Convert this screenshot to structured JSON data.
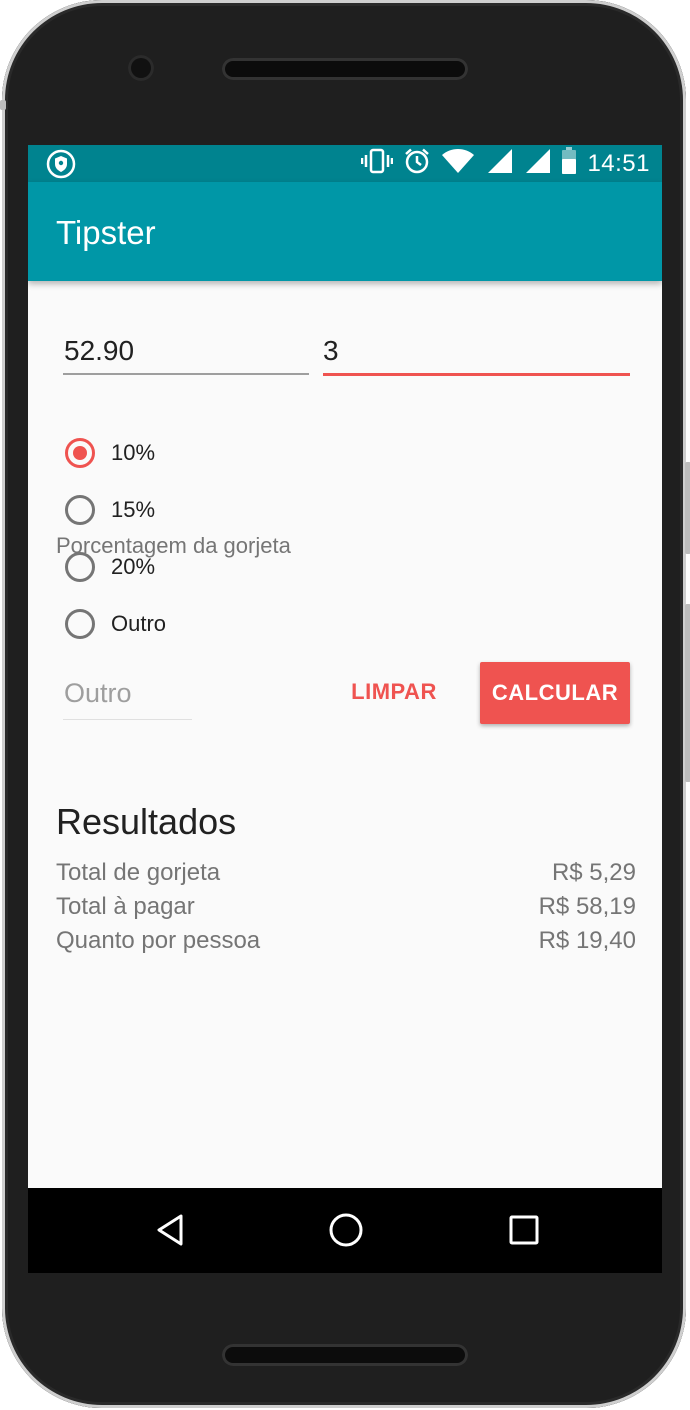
{
  "status_bar": {
    "time": "14:51",
    "icons": [
      "vpn-shield-icon",
      "vibrate-icon",
      "alarm-icon",
      "wifi-icon",
      "signal-icon",
      "signal-icon",
      "battery-icon"
    ]
  },
  "app_bar": {
    "title": "Tipster"
  },
  "form": {
    "amount_value": "52.90",
    "people_value": "3",
    "tip_label": "Porcentagem da gorjeta",
    "options": [
      {
        "label": "10%",
        "checked": true
      },
      {
        "label": "15%",
        "checked": false
      },
      {
        "label": "20%",
        "checked": false
      },
      {
        "label": "Outro",
        "checked": false
      }
    ],
    "other_placeholder": "Outro",
    "clear_label": "LIMPAR",
    "calculate_label": "CALCULAR"
  },
  "results": {
    "title": "Resultados",
    "rows": [
      {
        "label": "Total de gorjeta",
        "value": "R$ 5,29"
      },
      {
        "label": "Total à pagar",
        "value": "R$ 58,19"
      },
      {
        "label": "Quanto por pessoa",
        "value": "R$ 19,40"
      }
    ]
  },
  "nav_bar": {
    "icons": [
      "back-icon",
      "home-icon",
      "recents-icon"
    ]
  },
  "colors": {
    "status_bar": "#00838f",
    "app_bar": "#0097a7",
    "accent": "#ef5350",
    "background": "#fafafa"
  }
}
